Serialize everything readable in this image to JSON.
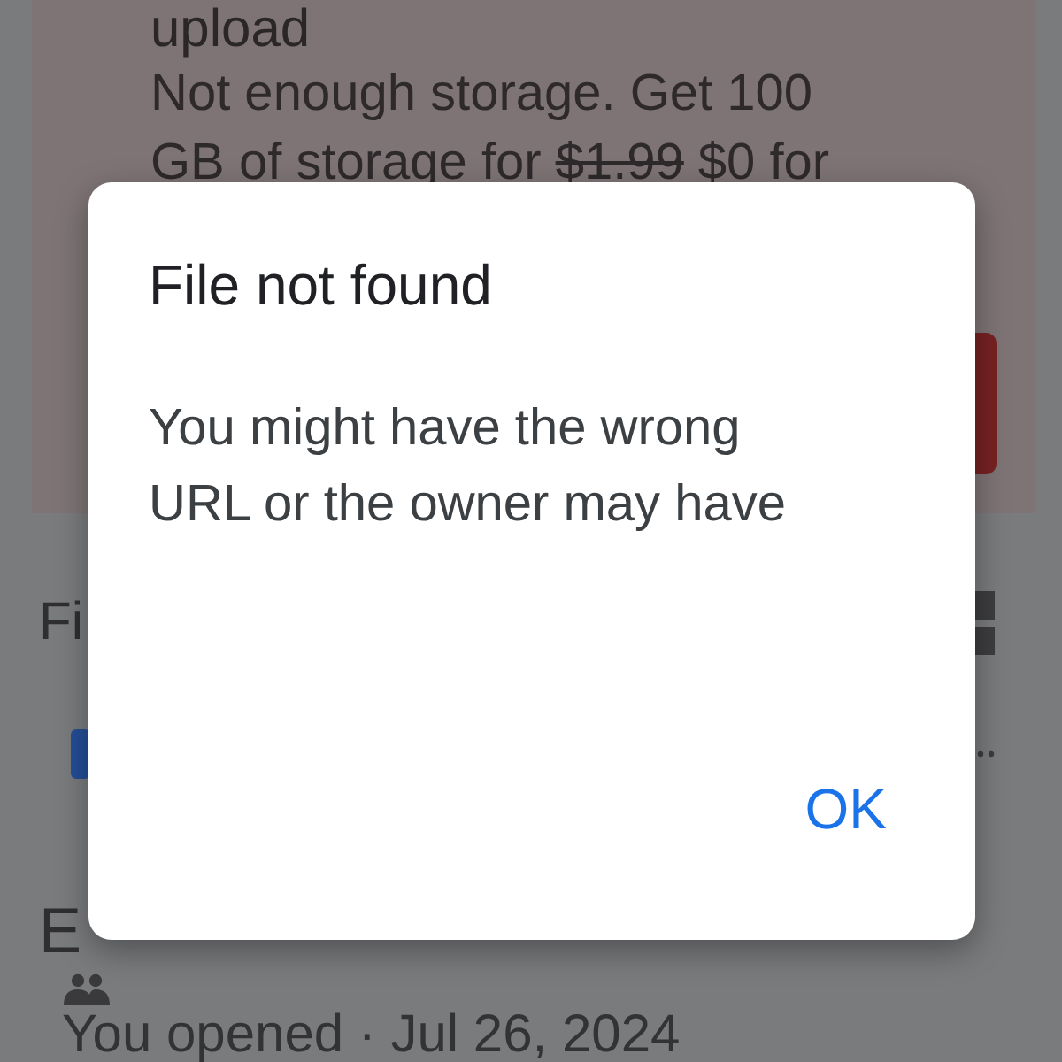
{
  "background": {
    "banner": {
      "title": "upload",
      "line_1": "Not enough storage. Get 100",
      "line_2": [
        {
          "text": "GB of storage for",
          "struck": false
        },
        {
          "text": "$1.99",
          "struck": true
        },
        {
          "text": "$0 for",
          "struck": false
        }
      ]
    },
    "section_heading": "Fi",
    "file": {
      "name": "E",
      "opened": "You opened · Jul 26, 2024"
    }
  },
  "dialog": {
    "title": "File not found",
    "message": "You might have the wrong URL or the owner may have",
    "buttons": [
      "OK"
    ]
  }
}
